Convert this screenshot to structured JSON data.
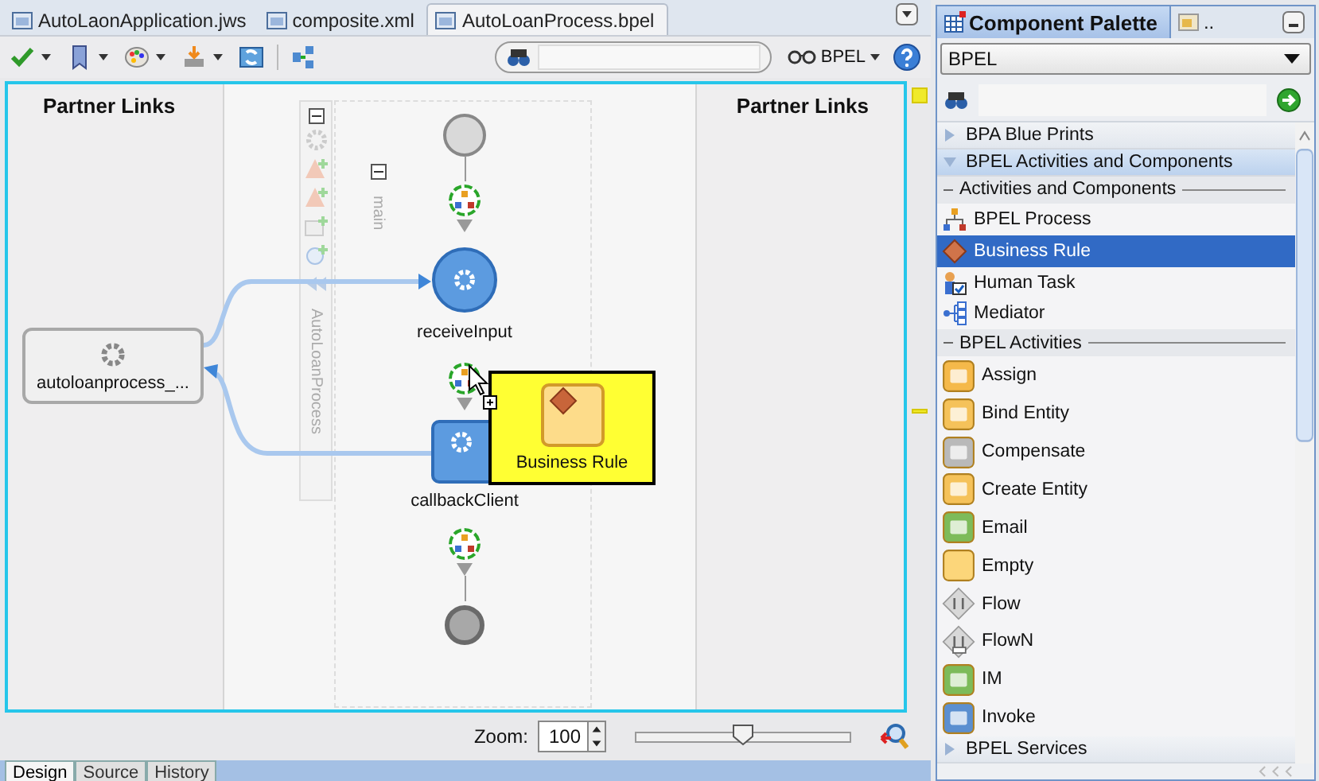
{
  "editor_tabs": [
    {
      "label": "AutoLaonApplication.jws",
      "selected": false
    },
    {
      "label": "composite.xml",
      "selected": false
    },
    {
      "label": "AutoLoanProcess.bpel",
      "selected": true
    }
  ],
  "toolbar": {
    "view_label": "BPEL"
  },
  "canvas": {
    "left_header": "Partner Links",
    "right_header": "Partner Links",
    "partner_link": "autoloanprocess_...",
    "process_label": "AutoLoanProcess",
    "scope_label": "main",
    "activities": [
      {
        "name": "receiveInput",
        "kind": "receive"
      },
      {
        "name": "callbackClient",
        "kind": "invoke"
      }
    ],
    "drag_tooltip": "Business Rule"
  },
  "zoom": {
    "label": "Zoom:",
    "value": "100",
    "level": 0.5
  },
  "bottom_tabs": [
    {
      "label": "Design",
      "selected": true
    },
    {
      "label": "Source",
      "selected": false
    },
    {
      "label": "History",
      "selected": false
    }
  ],
  "palette": {
    "tabs": [
      {
        "label": "Component Palette",
        "selected": true
      },
      {
        "label": "..",
        "selected": false
      }
    ],
    "category": "BPEL",
    "sections": [
      {
        "label": "BPA Blue Prints",
        "expanded": false
      },
      {
        "label": "BPEL Activities and Components",
        "expanded": true,
        "groups": [
          {
            "label": "Activities and Components",
            "items": [
              {
                "label": "BPEL Process",
                "kind": "process",
                "selected": false
              },
              {
                "label": "Business Rule",
                "kind": "rule",
                "selected": true
              },
              {
                "label": "Human Task",
                "kind": "task",
                "selected": false
              },
              {
                "label": "Mediator",
                "kind": "mediator",
                "selected": false
              }
            ]
          },
          {
            "label": "BPEL Activities",
            "items": [
              {
                "label": "Assign",
                "kind": "assign",
                "selected": false
              },
              {
                "label": "Bind Entity",
                "kind": "bind",
                "selected": false
              },
              {
                "label": "Compensate",
                "kind": "compensate",
                "selected": false
              },
              {
                "label": "Create Entity",
                "kind": "create",
                "selected": false
              },
              {
                "label": "Email",
                "kind": "email",
                "selected": false
              },
              {
                "label": "Empty",
                "kind": "empty",
                "selected": false
              },
              {
                "label": "Flow",
                "kind": "flow",
                "selected": false
              },
              {
                "label": "FlowN",
                "kind": "flown",
                "selected": false
              },
              {
                "label": "IM",
                "kind": "im",
                "selected": false
              },
              {
                "label": "Invoke",
                "kind": "invoke",
                "selected": false
              }
            ]
          }
        ]
      },
      {
        "label": "BPEL Services",
        "expanded": false
      }
    ]
  }
}
